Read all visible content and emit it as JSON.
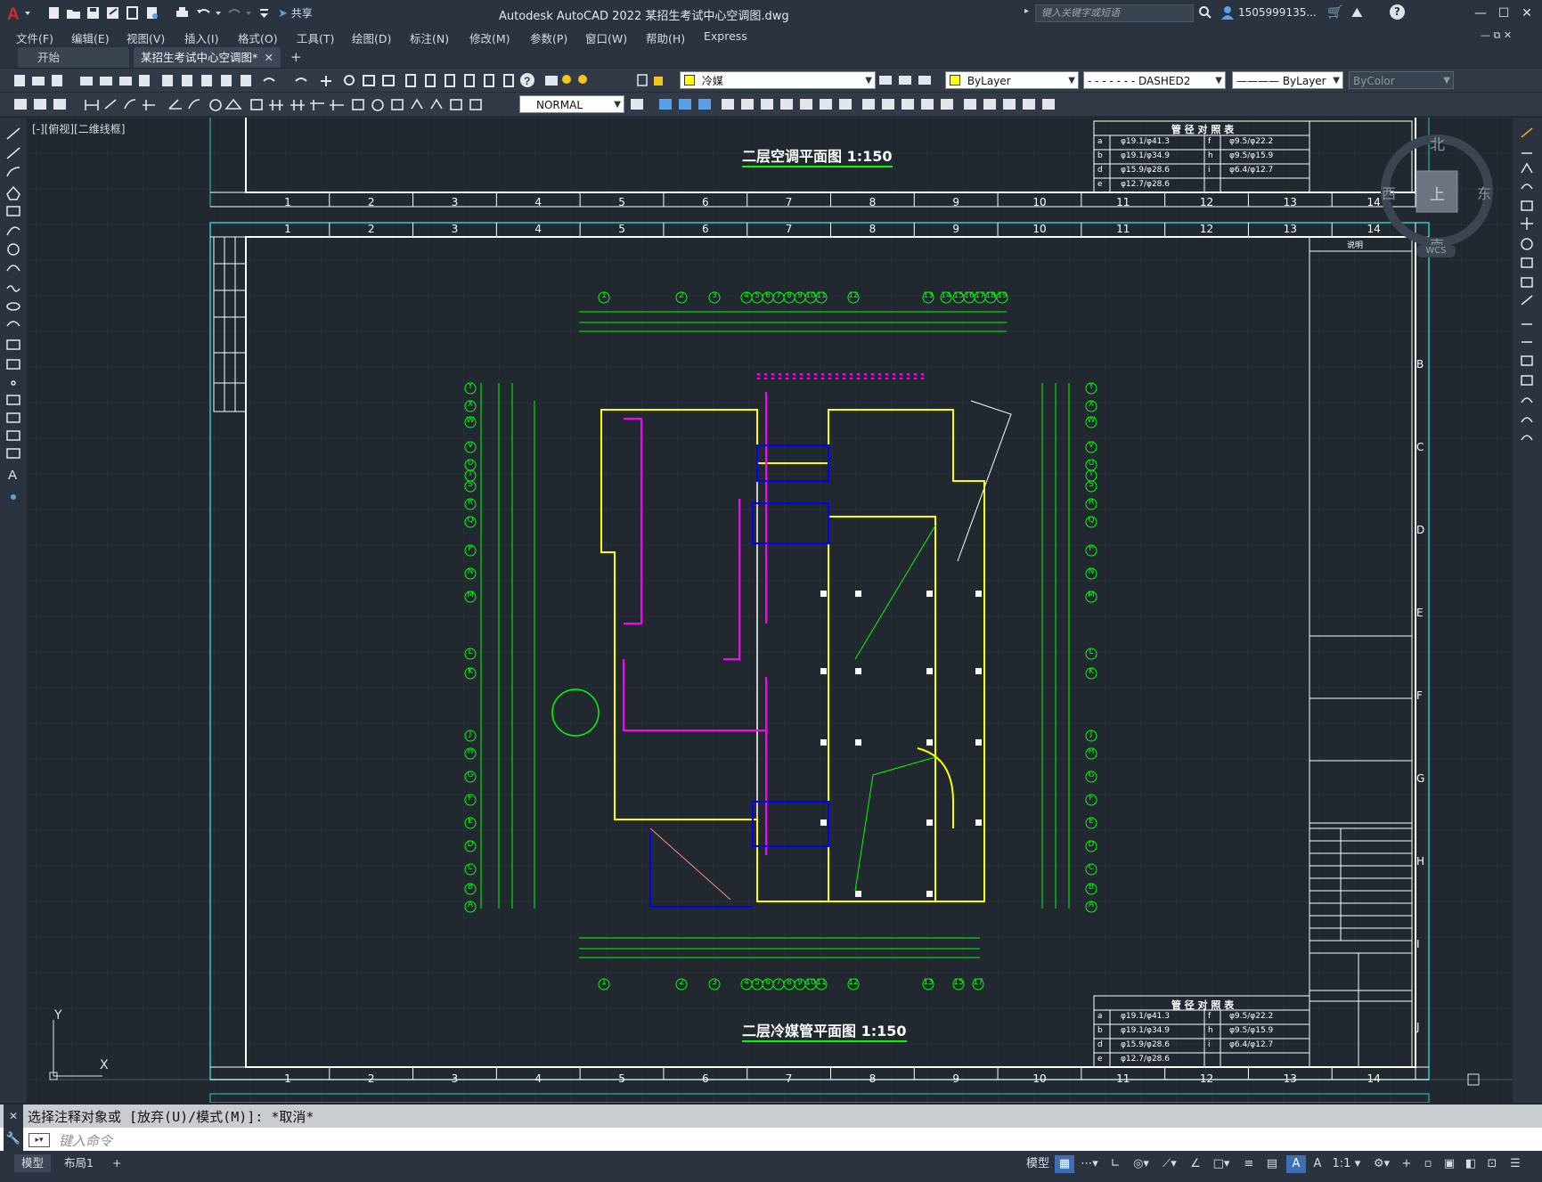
{
  "app": {
    "title": "Autodesk AutoCAD 2022    某招生考试中心空调图.dwg",
    "share_label": "共享",
    "search_placeholder": "键入关键字或短语",
    "user": "1505999135...",
    "brand_color": "#c2161b"
  },
  "menu": [
    "文件(F)",
    "编辑(E)",
    "视图(V)",
    "插入(I)",
    "格式(O)",
    "工具(T)",
    "绘图(D)",
    "标注(N)",
    "修改(M)",
    "参数(P)",
    "窗口(W)",
    "帮助(H)",
    "Express"
  ],
  "tabs": {
    "start": "开始",
    "doc": "某招生考试中心空调图*",
    "add": "+"
  },
  "toolbar": {
    "layer": "冷媒",
    "color": "ByLayer",
    "linetype": "- - - - - - -  DASHED2",
    "lineweight": "———— ByLayer",
    "plotstyle": "ByColor",
    "textstyle": "NORMAL"
  },
  "view_label": "[-][俯视][二维线框]",
  "drawing": {
    "upper_title": "二层空调平面图 1:150",
    "lower_title": "二层冷媒管平面图 1:150",
    "pipe_table_title": "管 径 对 照 表",
    "pipe_table_rows": [
      [
        "a",
        "φ19.1/φ41.3",
        "f",
        "φ9.5/φ22.2"
      ],
      [
        "b",
        "φ19.1/φ34.9",
        "h",
        "φ9.5/φ15.9"
      ],
      [
        "d",
        "φ15.9/φ28.6",
        "i",
        "φ6.4/φ12.7"
      ],
      [
        "e",
        "φ12.7/φ28.6",
        "",
        ""
      ]
    ],
    "note": "说明",
    "grid_numbers": [
      "1",
      "2",
      "3",
      "4",
      "5",
      "6",
      "7",
      "8",
      "9",
      "10",
      "11",
      "12",
      "13",
      "14"
    ],
    "row_letters": [
      "B",
      "C",
      "D",
      "E",
      "F",
      "G",
      "H",
      "I",
      "J"
    ],
    "col_axes_top": [
      "1",
      "2",
      "3",
      "4",
      "5",
      "6",
      "7",
      "8",
      "9",
      "10",
      "11",
      "12",
      "13",
      "14",
      "15",
      "16",
      "17",
      "18",
      "19"
    ],
    "col_axes_bottom": [
      "1",
      "2",
      "3",
      "4",
      "5",
      "6",
      "7",
      "8",
      "9",
      "10",
      "11",
      "12",
      "13",
      "15",
      "17"
    ],
    "row_axes": [
      "Y",
      "X",
      "W",
      "V",
      "U",
      "T",
      "S",
      "R",
      "Q",
      "P",
      "N",
      "M",
      "L",
      "K",
      "J",
      "H",
      "G",
      "F",
      "E",
      "D",
      "C",
      "B",
      "A"
    ],
    "compass": {
      "north": "北",
      "south": "南",
      "east": "东",
      "west": "西",
      "top": "上",
      "wcs": "WCS"
    },
    "ucs": {
      "x": "X",
      "y": "Y"
    }
  },
  "command": {
    "history": "选择注释对象或 [放弃(U)/模式(M)]: *取消*",
    "placeholder": "键入命令"
  },
  "status": {
    "model_tab": "模型",
    "layout_tab": "布局1",
    "add": "+",
    "model_space": "模型",
    "scale": "1:1"
  }
}
